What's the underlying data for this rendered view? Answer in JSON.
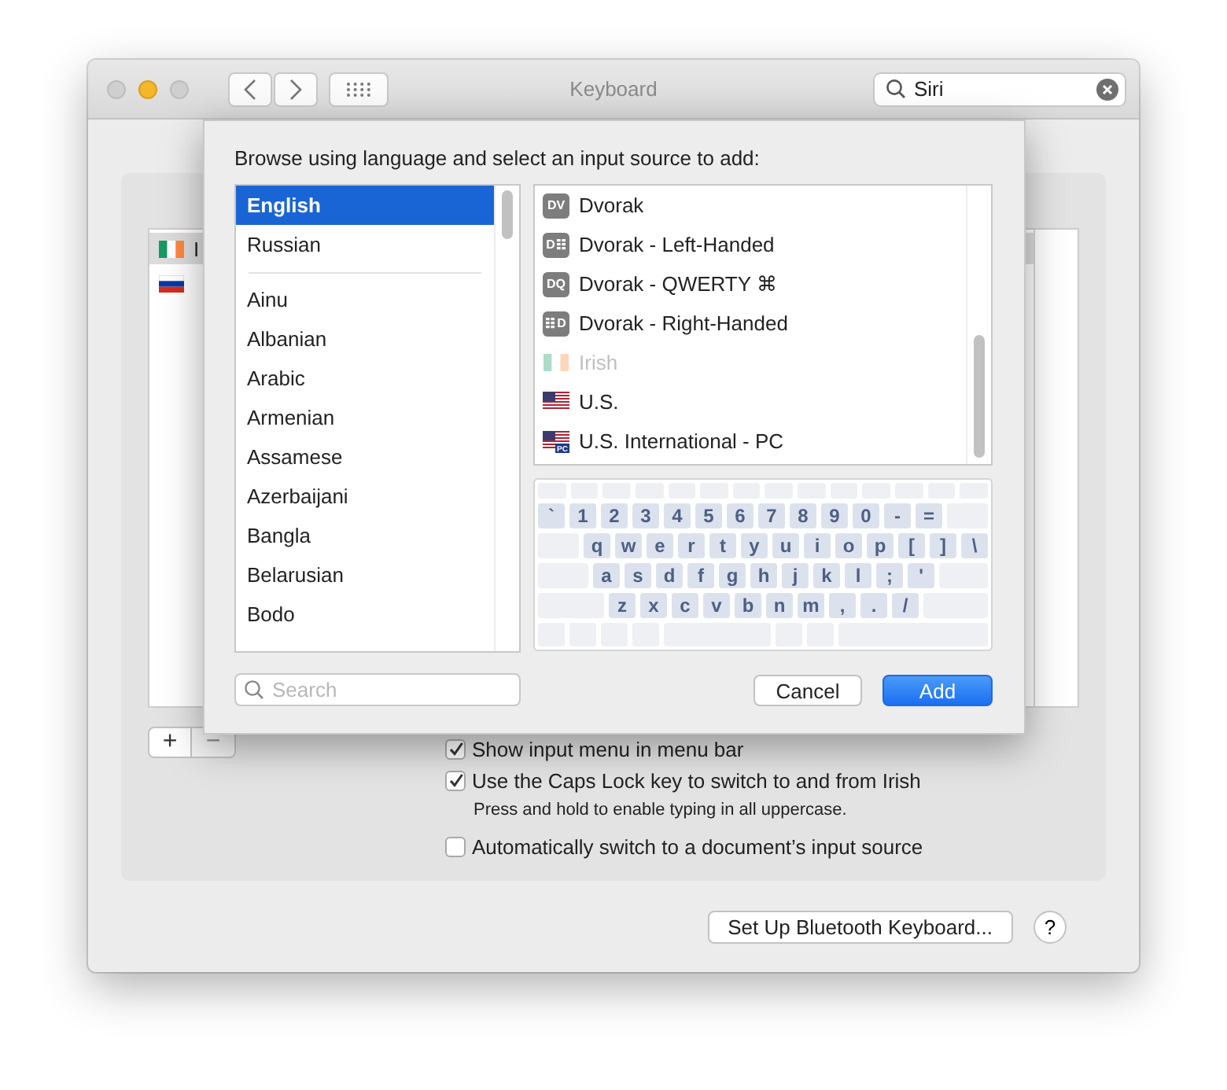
{
  "window": {
    "title": "Keyboard",
    "search": {
      "value": "Siri"
    }
  },
  "sources": [
    {
      "name": "I",
      "icon": {
        "kind": "flag-ie"
      },
      "selected": true
    },
    {
      "icon": {
        "kind": "flag-ru"
      },
      "selected": false
    }
  ],
  "add_remove": [
    {
      "label": "+",
      "disabled": false
    },
    {
      "label": "−",
      "disabled": true
    }
  ],
  "options": [
    {
      "label": "Show input menu in menu bar",
      "checked": true
    },
    {
      "label": "Use the Caps Lock key to switch to and from Irish",
      "checked": true,
      "note": "Press and hold to enable typing in all uppercase."
    },
    {
      "label": "Automatically switch to a document’s input source",
      "checked": false
    }
  ],
  "bluetooth_button": "Set Up Bluetooth Keyboard...",
  "help_button": "?",
  "sheet": {
    "prompt": "Browse using language and select an input source to add:",
    "languages": {
      "preferred": [
        {
          "label": "English",
          "selected": true
        },
        {
          "label": "Russian",
          "selected": false
        }
      ],
      "all": [
        {
          "label": "Ainu",
          "selected": false
        },
        {
          "label": "Albanian",
          "selected": false
        },
        {
          "label": "Arabic",
          "selected": false
        },
        {
          "label": "Armenian",
          "selected": false
        },
        {
          "label": "Assamese",
          "selected": false
        },
        {
          "label": "Azerbaijani",
          "selected": false
        },
        {
          "label": "Bangla",
          "selected": false
        },
        {
          "label": "Belarusian",
          "selected": false
        },
        {
          "label": "Bodo",
          "selected": false
        }
      ]
    },
    "search": {
      "placeholder": "Search"
    },
    "input_sources": [
      {
        "name": "Dvorak",
        "icon": {
          "kind": "badge",
          "text": "DV"
        },
        "disabled": false,
        "selected": false
      },
      {
        "name": "Dvorak - Left-Handed",
        "icon": {
          "kind": "badge-grid-right",
          "text": "D"
        },
        "disabled": false,
        "selected": false
      },
      {
        "name": "Dvorak - QWERTY ⌘",
        "icon": {
          "kind": "badge",
          "text": "DQ"
        },
        "disabled": false,
        "selected": false
      },
      {
        "name": "Dvorak - Right-Handed",
        "icon": {
          "kind": "badge-grid-left",
          "text": "D"
        },
        "disabled": false,
        "selected": false
      },
      {
        "name": "Irish",
        "icon": {
          "kind": "flag-ie"
        },
        "disabled": true,
        "selected": false
      },
      {
        "name": "U.S.",
        "icon": {
          "kind": "flag-us"
        },
        "disabled": false,
        "selected": false
      },
      {
        "name": "U.S. International - PC",
        "icon": {
          "kind": "flag-us-pc",
          "text": "PC"
        },
        "disabled": false,
        "selected": false
      }
    ],
    "keyboard": {
      "rows": [
        [
          "`",
          "1",
          "2",
          "3",
          "4",
          "5",
          "6",
          "7",
          "8",
          "9",
          "0",
          "-",
          "="
        ],
        [
          "q",
          "w",
          "e",
          "r",
          "t",
          "y",
          "u",
          "i",
          "o",
          "p",
          "[",
          "]",
          "\\"
        ],
        [
          "a",
          "s",
          "d",
          "f",
          "g",
          "h",
          "j",
          "k",
          "l",
          ";",
          "'"
        ],
        [
          "z",
          "x",
          "c",
          "v",
          "b",
          "n",
          "m",
          ",",
          ".",
          "/"
        ]
      ]
    },
    "buttons": [
      {
        "label": "Cancel",
        "kind": "secondary"
      },
      {
        "label": "Add",
        "kind": "primary"
      }
    ]
  }
}
